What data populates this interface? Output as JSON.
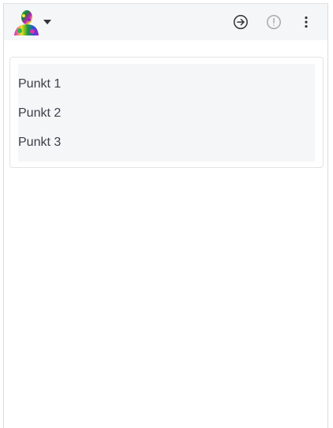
{
  "toolbar": {
    "avatar_icon": "user-avatar-icon",
    "menu_caret_icon": "caret-down-icon",
    "actions": [
      {
        "icon": "arrow-right-circle-icon"
      },
      {
        "icon": "alert-circle-icon"
      },
      {
        "icon": "more-vertical-icon"
      }
    ]
  },
  "list": {
    "items": [
      {
        "label": "Punkt 1"
      },
      {
        "label": "Punkt 2"
      },
      {
        "label": "Punkt 3"
      }
    ]
  },
  "colors": {
    "toolbar_bg": "#f5f6f8",
    "list_bg": "#f5f6f8",
    "text": "#3d4049",
    "icon": "#333333",
    "icon_muted": "#aaaaaa"
  }
}
